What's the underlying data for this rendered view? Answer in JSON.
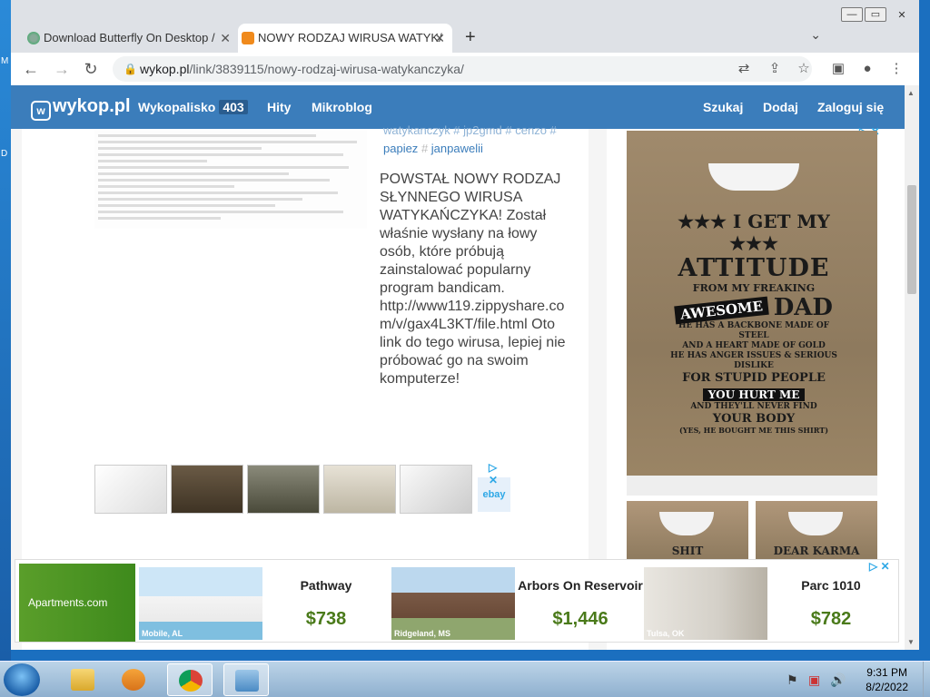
{
  "desktop": {
    "labels": [
      "M",
      "D"
    ]
  },
  "window": {
    "minimize": "—",
    "maximize": "▭",
    "close": "✕"
  },
  "tabs": [
    {
      "title": "Download Butterfly On Desktop /",
      "close": "✕"
    },
    {
      "title": "NOWY RODZAJ WIRUSA WATYK/",
      "close": "✕"
    }
  ],
  "toolbar": {
    "back": "←",
    "forward": "→",
    "reload": "↻",
    "newtab": "+",
    "tabmenu": "⌄",
    "url_host": "wykop.pl",
    "url_path": "/link/3839115/nowy-rodzaj-wirusa-watykanczyka/",
    "lock": "🔒",
    "translate": "⇄",
    "share": "⇪",
    "star": "☆",
    "sidepanel": "▣",
    "profile": "●",
    "menu": "⋮"
  },
  "site": {
    "logo": "wykop.pl",
    "logo_mark": "w",
    "nav": [
      {
        "label": "Wykopalisko",
        "badge": "403"
      },
      {
        "label": "Hity"
      },
      {
        "label": "Mikroblog"
      }
    ],
    "right_nav": [
      "Szukaj",
      "Dodaj",
      "Zaloguj się"
    ]
  },
  "article": {
    "tags_line1": "watykanczyk # jp2gmd # cenzo #",
    "tags_line2": [
      "papiez",
      "janpawelii"
    ],
    "hash": "#",
    "body": "POWSTAŁ NOWY RODZAJ SŁYNNEGO WIRUSA WATYKAŃCZYKA! Został właśnie wysłany na łowy osób, które próbują zainstalować popularny program bandicam. http://www119.zippyshare.com/v/gax4L3KT/file.html Oto link do tego wirusa, lepiej nie próbować go na swoim komputerze!",
    "ad_choices": "▷ ✕",
    "ebay": "ebay"
  },
  "side_ad": {
    "ad_choices": "▷ ✕",
    "line1": "★★★ I GET MY ★★★",
    "line2": "ATTITUDE",
    "line3": "FROM MY FREAKING",
    "awesome": "AWESOME",
    "dad": "DAD",
    "line4": "HE HAS A BACKBONE MADE OF STEEL",
    "line5": "AND A HEART MADE OF GOLD",
    "line6": "HE HAS ANGER ISSUES & SERIOUS DISLIKE",
    "line7": "FOR STUPID PEOPLE",
    "hurt": "YOU HURT ME",
    "line8": "AND THEY'LL NEVER FIND",
    "line9": "YOUR BODY",
    "line10": "(YES, HE BOUGHT ME THIS SHIRT)",
    "sub1": "SHIT",
    "sub2": "DEAR KARMA"
  },
  "bottom_ad": {
    "brand": "Apartments.com",
    "ad_choices": "▷ ✕",
    "listings": [
      {
        "city": "Mobile, AL",
        "name": "Pathway",
        "price": "$738"
      },
      {
        "city": "Ridgeland, MS",
        "name": "Arbors On Reservoir",
        "price": "$1,446"
      },
      {
        "city": "Tulsa, OK",
        "name": "Parc 1010",
        "price": "$782"
      }
    ]
  },
  "taskbar": {
    "time": "9:31 PM",
    "date": "8/2/2022",
    "tray_icons": [
      "⚑",
      "▣",
      "🔊"
    ]
  }
}
